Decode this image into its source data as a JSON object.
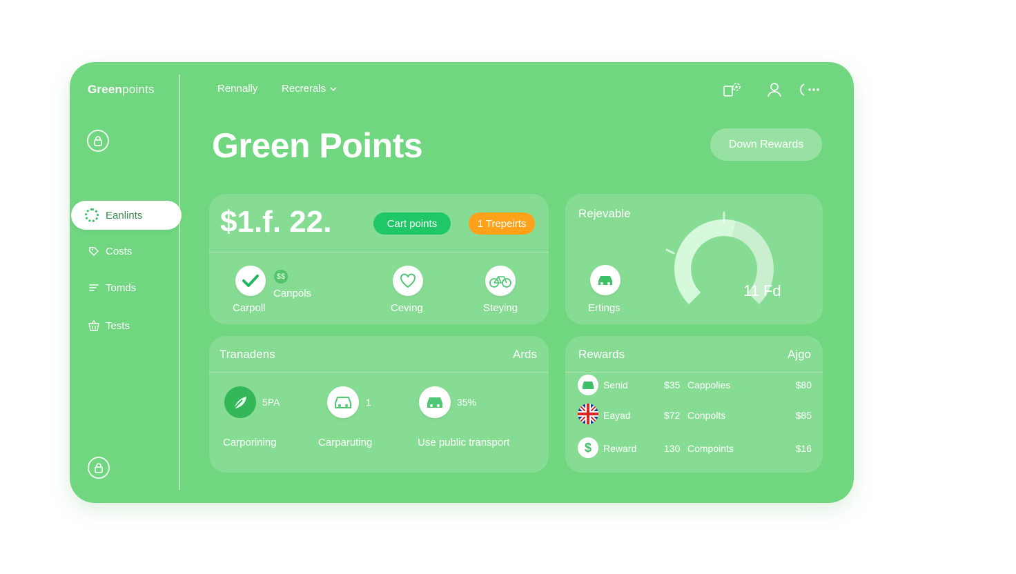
{
  "app": {
    "brand_bold": "Green",
    "brand_light": "points",
    "title": "Green Points",
    "cta_label": "Down Rewards"
  },
  "topnav": {
    "items": [
      "Rennally",
      "Recrerals"
    ],
    "icons": [
      "gear-icon",
      "user-icon",
      "more-icon"
    ]
  },
  "sidebar": {
    "items": [
      {
        "label": "Eanlints",
        "icon": "ring-icon",
        "active": true
      },
      {
        "label": "Costs",
        "icon": "tag-icon"
      },
      {
        "label": "Tomds",
        "icon": "list-icon"
      },
      {
        "label": "Tests",
        "icon": "basket-icon"
      }
    ]
  },
  "balance_card": {
    "value": "$1.f. 22.",
    "pill_green": "Cart points",
    "pill_orange": "1 Trepeirts",
    "badge": "$$",
    "activities": [
      {
        "label": "Carpoll",
        "icon": "check-icon"
      },
      {
        "label": "Canpols",
        "icon": "coin-icon"
      },
      {
        "label": "Ceving",
        "icon": "heart-icon"
      },
      {
        "label": "Steying",
        "icon": "bicycle-icon"
      }
    ]
  },
  "gauge_card": {
    "title": "Rejevable",
    "item_label": "Ertings",
    "gauge_value": "11 Fd",
    "progress": 0.55
  },
  "transactions_card": {
    "title": "Tranadens",
    "right_label": "Ards",
    "items": [
      {
        "label": "Carporining",
        "value": "5PA",
        "icon": "leaf-icon"
      },
      {
        "label": "Carparuting",
        "value": "1",
        "icon": "car-icon"
      },
      {
        "label": "Use public transport",
        "value": "35%",
        "icon": "car-icon"
      }
    ]
  },
  "rewards_card": {
    "title": "Rewards",
    "right_label": "Ajgo",
    "rows": [
      {
        "name": "Senid",
        "points": "$35",
        "type": "Cappolies",
        "amount": "$80",
        "icon": "car-icon"
      },
      {
        "name": "Eayad",
        "points": "$72",
        "type": "Conpolts",
        "amount": "$85",
        "icon": "flag-icon"
      },
      {
        "name": "Reward",
        "points": "130",
        "type": "Compoints",
        "amount": "$16",
        "icon": "dollar-icon"
      }
    ]
  },
  "colors": {
    "background": "#70d680",
    "accent_green": "#1fc767",
    "accent_orange": "#ffa21a"
  }
}
